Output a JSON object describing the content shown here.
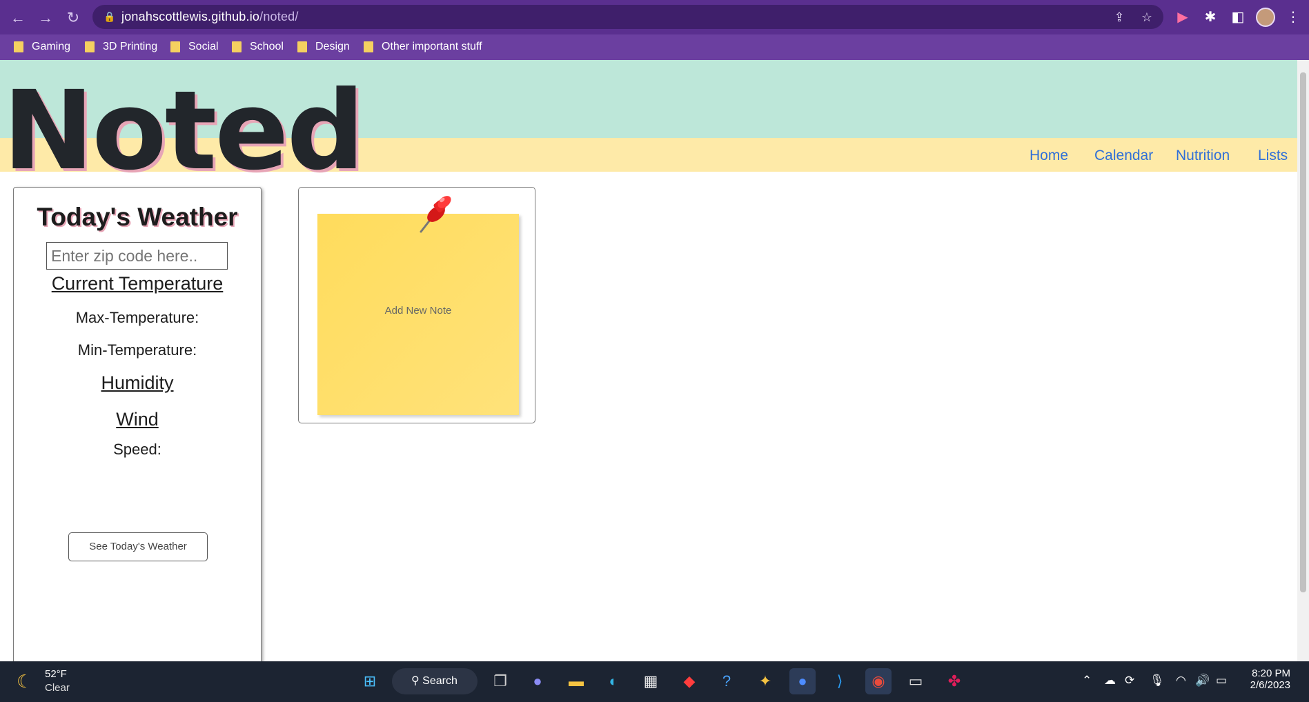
{
  "browser": {
    "url_domain": "jonahscottlewis.github.io",
    "url_path": "/noted/",
    "bookmarks": [
      "Gaming",
      "3D Printing",
      "Social",
      "School",
      "Design",
      "Other important stuff"
    ]
  },
  "site": {
    "logo": "Noted",
    "nav": [
      "Home",
      "Calendar",
      "Nutrition",
      "Lists"
    ]
  },
  "weather": {
    "title": "Today's Weather",
    "zip_placeholder": "Enter zip code here..",
    "current_temperature": "Current Temperature",
    "max_temperature": "Max-Temperature:",
    "min_temperature": "Min-Temperature:",
    "humidity": "Humidity",
    "wind": "Wind",
    "speed": "Speed:",
    "button": "See Today's Weather"
  },
  "note": {
    "add_label": "Add New Note"
  },
  "taskbar": {
    "temp": "52°F",
    "condition": "Clear",
    "search": "Search",
    "time": "8:20 PM",
    "date": "2/6/2023"
  }
}
